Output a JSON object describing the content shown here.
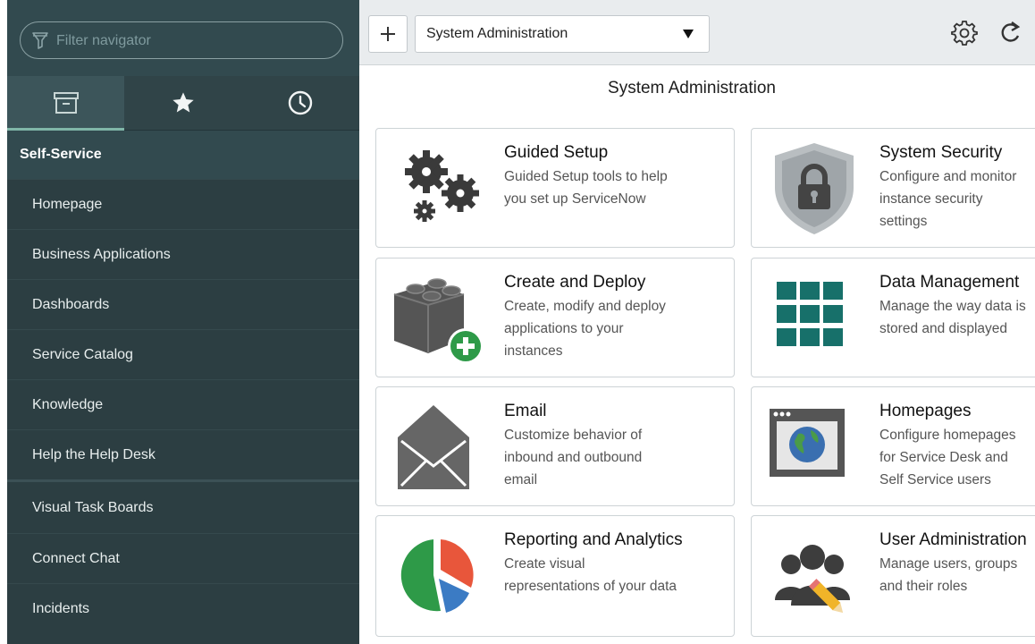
{
  "sidebar": {
    "filter_placeholder": "Filter navigator",
    "tabs": [
      {
        "icon": "archive-icon",
        "active": true
      },
      {
        "icon": "star-icon",
        "active": false
      },
      {
        "icon": "clock-icon",
        "active": false
      }
    ],
    "section_header": "Self-Service",
    "items": [
      "Homepage",
      "Business Applications",
      "Dashboards",
      "Service Catalog",
      "Knowledge",
      "Help the Help Desk",
      "Visual Task Boards",
      "Connect Chat",
      "Incidents"
    ]
  },
  "header": {
    "dropdown_value": "System Administration"
  },
  "main": {
    "title": "System Administration",
    "cards": [
      {
        "title": "Guided Setup",
        "desc": "Guided Setup tools to help\nyou set up ServiceNow",
        "icon": "gears-icon"
      },
      {
        "title": "System Security",
        "desc": "Configure and monitor\ninstance security\nsettings",
        "icon": "shield-lock-icon"
      },
      {
        "title": "Create and Deploy",
        "desc": "Create, modify and deploy\napplications to your\ninstances",
        "icon": "blocks-plus-icon"
      },
      {
        "title": "Data Management",
        "desc": "Manage the way data is\nstored and displayed",
        "icon": "grid-icon"
      },
      {
        "title": "Email",
        "desc": "Customize behavior of\ninbound and outbound\nemail",
        "icon": "envelope-icon"
      },
      {
        "title": "Homepages",
        "desc": "Configure homepages\nfor Service Desk and\nSelf Service users",
        "icon": "browser-globe-icon"
      },
      {
        "title": "Reporting and Analytics",
        "desc": "Create visual\nrepresentations of your data",
        "icon": "pie-chart-icon"
      },
      {
        "title": "User Administration",
        "desc": "Manage users, groups\nand their roles",
        "icon": "users-pencil-icon"
      }
    ]
  },
  "colors": {
    "sidebar_bg": "#2c3e42",
    "accent": "#80b6a8",
    "teal": "#17706a",
    "green": "#2e9a48"
  }
}
